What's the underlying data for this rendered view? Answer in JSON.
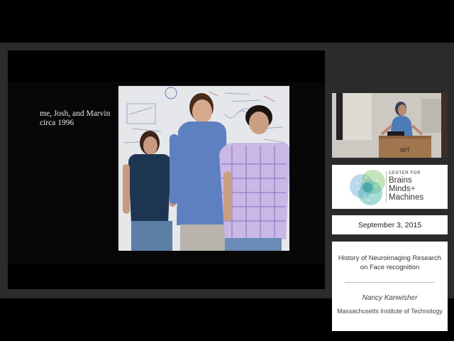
{
  "slide": {
    "caption_line1": "me, Josh, and Marvin",
    "caption_line2": "circa 1996"
  },
  "logo": {
    "line1": "CENTER FOR",
    "line2": "Brains",
    "line3": "Minds",
    "line3_plus": "+",
    "line4": "Machines"
  },
  "event": {
    "date": "September 3, 2015"
  },
  "talk": {
    "title": "History of Neuroimaging Research on Face recognition",
    "presenter": "Nancy Kanwisher",
    "affiliation": "Massachusetts Institute of Technology"
  },
  "colors": {
    "logo_teal": "#4fb8b0",
    "logo_blue": "#6aa8d8",
    "logo_green": "#7cc46a"
  }
}
